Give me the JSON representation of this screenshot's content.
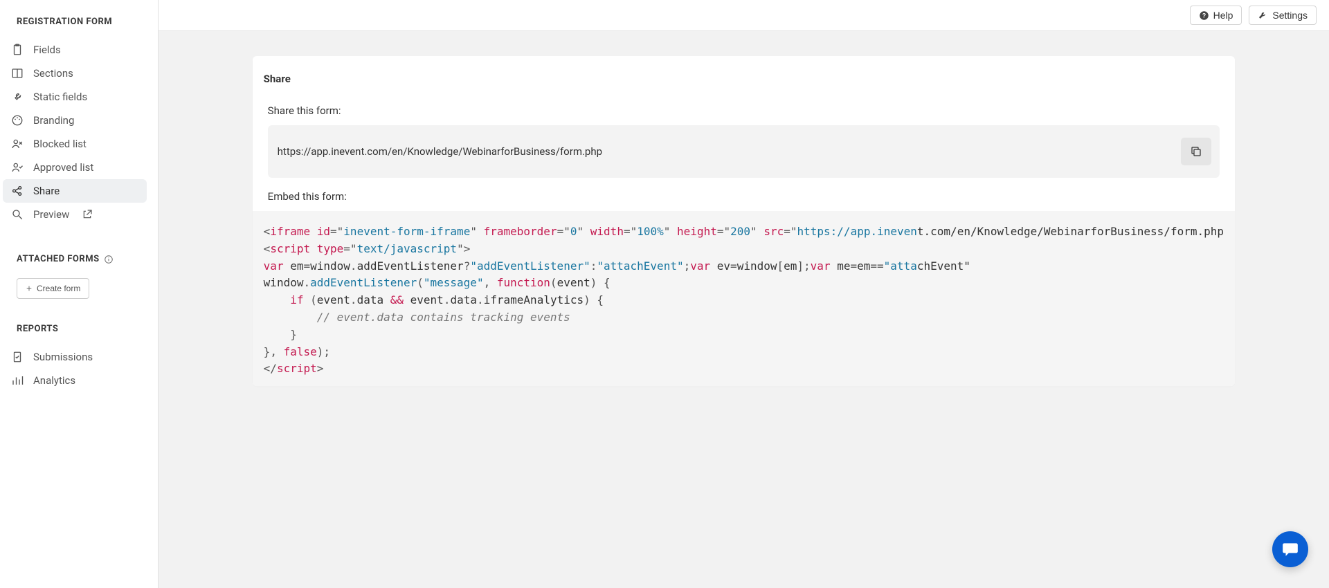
{
  "sidebar": {
    "section_registration": "REGISTRATION FORM",
    "items": [
      {
        "label": "Fields"
      },
      {
        "label": "Sections"
      },
      {
        "label": "Static fields"
      },
      {
        "label": "Branding"
      },
      {
        "label": "Blocked list"
      },
      {
        "label": "Approved list"
      },
      {
        "label": "Share"
      },
      {
        "label": "Preview"
      }
    ],
    "section_attached": "ATTACHED FORMS",
    "create_form": "Create form",
    "section_reports": "REPORTS",
    "reports": [
      {
        "label": "Submissions"
      },
      {
        "label": "Analytics"
      }
    ]
  },
  "topbar": {
    "help": "Help",
    "settings": "Settings"
  },
  "card": {
    "title": "Share",
    "share_label": "Share this form:",
    "url": "https://app.inevent.com/en/Knowledge/WebinarforBusiness/form.php",
    "embed_label": "Embed this form:"
  },
  "code": {
    "line1": {
      "open": "<",
      "tag": "iframe",
      "attrs": [
        {
          "name": "id",
          "eq": "=",
          "q1": "\"",
          "val": "inevent-form-iframe",
          "q2": "\""
        },
        {
          "name": "frameborder",
          "eq": "=",
          "q1": "\"",
          "val": "0",
          "q2": "\""
        },
        {
          "name": "width",
          "eq": "=",
          "q1": "\"",
          "val": "100%",
          "q2": "\""
        },
        {
          "name": "height",
          "eq": "=",
          "q1": "\"",
          "val": "200",
          "q2": "\""
        },
        {
          "name": "src",
          "eq": "=",
          "q1": "\"",
          "val": "https://app.ineven",
          "q2": ""
        }
      ]
    },
    "line2": {
      "open": "<",
      "tag": "script",
      "attr_name": "type",
      "eq": "=",
      "q1": "\"",
      "val": "text/javascript",
      "q2": "\"",
      "close": ">"
    },
    "line3": {
      "kw1": "var",
      "id1": "em",
      "assign1": "=",
      "id2": "window",
      "dot1": ".",
      "id3": "addEventListener",
      "tern": "?",
      "str1": "\"addEventListener\"",
      "colon": ":",
      "str2": "\"attachEvent\"",
      "semi1": ";",
      "kw2": "var",
      "id4": "ev",
      "assign2": "=",
      "id5": "window",
      "br1": "[",
      "id6": "em",
      "br2": "]",
      "semi2": ";",
      "kw3": "var",
      "id7": "me",
      "assign3": "=",
      "id8": "em",
      "eqeq": "==",
      "str3": "\"atta"
    },
    "line4": {
      "id1": "window",
      "dot": ".",
      "func": "addEventListener",
      "paren1": "(",
      "str1": "\"message\"",
      "comma": ",",
      "kw": "function",
      "paren2": "(",
      "id2": "event",
      "paren3": ")",
      "brace": "{"
    },
    "line5": {
      "pad": "    ",
      "kw": "if",
      "paren1": "(",
      "id1": "event",
      "dot1": ".",
      "id2": "data",
      "and": "&&",
      "id3": "event",
      "dot2": ".",
      "id4": "data",
      "dot3": ".",
      "id5": "iframeAnalytics",
      "paren2": ")",
      "brace": "{"
    },
    "line6": {
      "pad": "        ",
      "comment": "// event.data contains tracking events"
    },
    "line7": {
      "pad": "    ",
      "brace": "}"
    },
    "line8": {
      "brace": "}",
      "comma": ",",
      "kw": "false",
      "paren": ")",
      "semi": ";"
    },
    "line9": {
      "open": "</",
      "tag": "script",
      "close": ">"
    }
  }
}
